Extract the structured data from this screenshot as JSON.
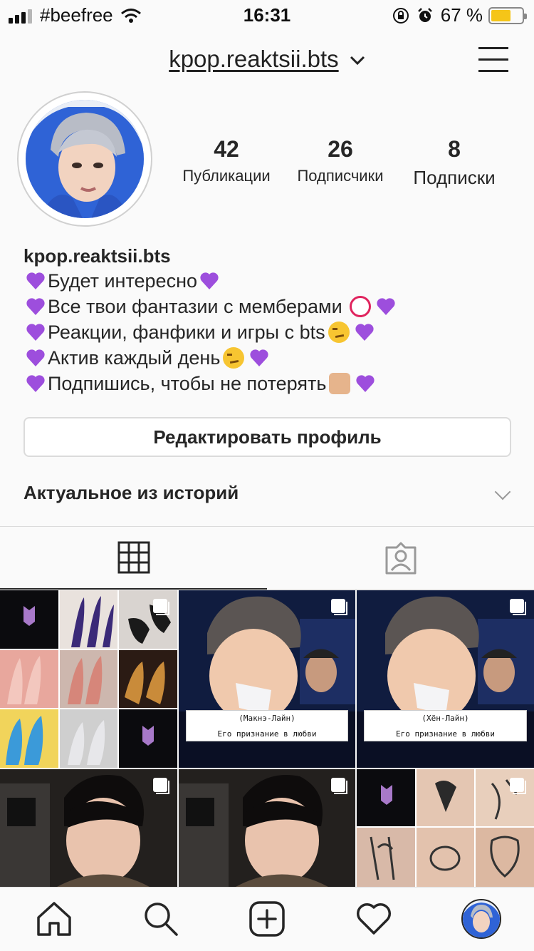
{
  "status_bar": {
    "carrier": "#beefree",
    "time": "16:31",
    "battery_percent": "67 %",
    "battery_level": 0.67
  },
  "header": {
    "username": "kpop.reaktsii.bts",
    "dropdown_icon": "chevron-down-icon",
    "menu_icon": "hamburger-menu-icon"
  },
  "profile": {
    "stats": [
      {
        "value": "42",
        "label": "Публикации"
      },
      {
        "value": "26",
        "label": "Подписчики"
      },
      {
        "value": "8",
        "label": "Подписки"
      }
    ],
    "name": "kpop.reaktsii.bts",
    "bio": [
      "Будет интересно",
      "Все твои фантазии с мемберами",
      "Реакции, фанфики и игры с bts",
      "Актив каждый день",
      "Подпишись, чтобы не потерять"
    ],
    "edit_profile_label": "Редактировать профиль",
    "highlights_label": "Актуальное из историй"
  },
  "colors": {
    "heart": "#9d4edd",
    "text": "#262626",
    "border": "#dbdbdb"
  },
  "posts": {
    "captions": [
      {
        "top": "(Макнэ-Лайн)",
        "bottom": "Его признание в любви"
      },
      {
        "top": "(Хён-Лайн)",
        "bottom": "Его признание в любви"
      }
    ],
    "logo_text": "BTS"
  },
  "tabbar": {
    "icons": [
      "home-icon",
      "search-icon",
      "new-post-icon",
      "activity-heart-icon",
      "profile-avatar"
    ]
  }
}
